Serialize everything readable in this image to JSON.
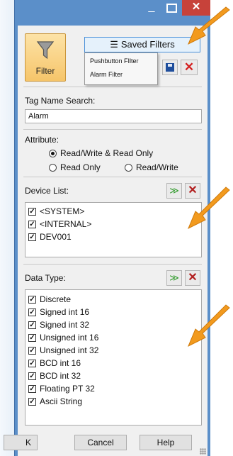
{
  "titlebar": {
    "minimize": "_",
    "maximize": "",
    "close": "✕"
  },
  "toolbar": {
    "filter_label": "Filter",
    "saved_filters_label": "Saved Filters",
    "saved_filters_menu": [
      "Pushbutton FIlter",
      "Alarm Filter"
    ],
    "delete_symbol": "✕"
  },
  "tag_search": {
    "label": "Tag Name Search:",
    "value": "Alarm"
  },
  "attribute": {
    "label": "Attribute:",
    "options": [
      "Read/Write & Read Only",
      "Read Only",
      "Read/Write"
    ],
    "selected": "Read/Write & Read Only"
  },
  "device_list": {
    "label": "Device List:",
    "items": [
      {
        "label": "<SYSTEM>",
        "checked": true
      },
      {
        "label": "<INTERNAL>",
        "checked": true
      },
      {
        "label": "DEV001",
        "checked": true
      }
    ]
  },
  "data_type": {
    "label": "Data Type:",
    "items": [
      {
        "label": "Discrete",
        "checked": true
      },
      {
        "label": "Signed int 16",
        "checked": true
      },
      {
        "label": "Signed int 32",
        "checked": true
      },
      {
        "label": "Unsigned int 16",
        "checked": true
      },
      {
        "label": "Unsigned int 32",
        "checked": true
      },
      {
        "label": "BCD int 16",
        "checked": true
      },
      {
        "label": "BCD int 32",
        "checked": true
      },
      {
        "label": "Floating PT 32",
        "checked": true
      },
      {
        "label": "Ascii String",
        "checked": true
      }
    ]
  },
  "list_icons": {
    "select_all": "≫",
    "clear_all": "✕"
  },
  "footer": {
    "ok_label": "K",
    "cancel_label": "Cancel",
    "help_label": "Help"
  },
  "check_glyph": "✓",
  "colors": {
    "accent_window": "#5b8fc9",
    "arrow": "#f29a1e",
    "close": "#c7423a",
    "filter_button": "#f6c56a"
  }
}
